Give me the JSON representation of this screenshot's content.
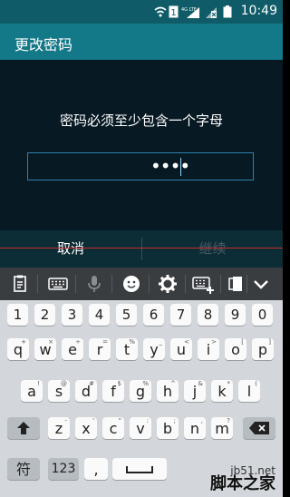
{
  "status_bar": {
    "time": "10:49",
    "icons": [
      "wifi-icon",
      "sim-1-icon",
      "lte-signal-icon",
      "no-sim-icon",
      "battery-icon"
    ]
  },
  "app_bar": {
    "title": "更改密码"
  },
  "content": {
    "prompt": "密码必须至少包含一个字母",
    "password_value": "••••"
  },
  "actions": {
    "cancel_label": "取消",
    "continue_label": "继续"
  },
  "toolbar": {
    "icons": [
      "clipboard-icon",
      "keyboard-icon",
      "microphone-icon",
      "emoji-icon",
      "settings-gear-icon",
      "keyboard-layout-icon",
      "split-icon",
      "collapse-chevron-icon"
    ]
  },
  "keyboard": {
    "row_numbers": [
      "1",
      "2",
      "3",
      "4",
      "5",
      "6",
      "7",
      "8",
      "9",
      "0"
    ],
    "row1": [
      {
        "key": "q",
        "sub": "+"
      },
      {
        "key": "w",
        "sub": "×"
      },
      {
        "key": "e",
        "sub": "÷"
      },
      {
        "key": "r",
        "sub": "="
      },
      {
        "key": "t",
        "sub": "%"
      },
      {
        "key": "y",
        "sub": "_"
      },
      {
        "key": "u",
        "sub": "<"
      },
      {
        "key": "i",
        "sub": ">"
      },
      {
        "key": "o",
        "sub": "["
      },
      {
        "key": "p",
        "sub": "]"
      }
    ],
    "row2": [
      {
        "key": "a",
        "sub": "!"
      },
      {
        "key": "s",
        "sub": "@"
      },
      {
        "key": "d",
        "sub": "#"
      },
      {
        "key": "f",
        "sub": "$"
      },
      {
        "key": "g",
        "sub": "%"
      },
      {
        "key": "h",
        "sub": "^"
      },
      {
        "key": "j",
        "sub": "&"
      },
      {
        "key": "k",
        "sub": "*"
      },
      {
        "key": "l",
        "sub": "("
      }
    ],
    "row3": [
      {
        "key": "z",
        "sub": "-"
      },
      {
        "key": "x",
        "sub": "'"
      },
      {
        "key": "c",
        "sub": "\""
      },
      {
        "key": "v",
        "sub": ":"
      },
      {
        "key": "b",
        "sub": ";"
      },
      {
        "key": "n",
        "sub": ","
      },
      {
        "key": "m",
        "sub": "?"
      }
    ],
    "bottom": {
      "symbols": "符",
      "numbers": "123",
      "comma": ","
    }
  },
  "watermark": {
    "url": "jb51.net",
    "name": "脚本之家"
  }
}
